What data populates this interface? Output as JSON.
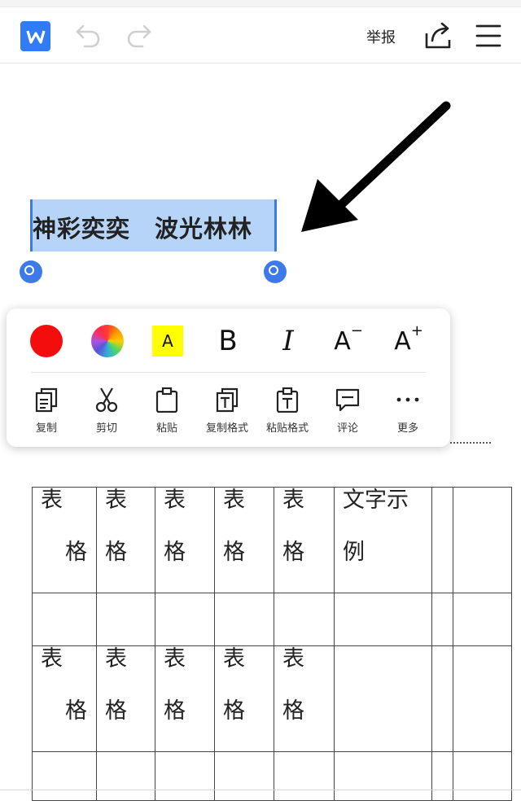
{
  "toolbar": {
    "logo_letter": "W",
    "report_label": "举报",
    "icons": [
      "wps-logo-icon",
      "undo-icon",
      "redo-icon",
      "share-icon",
      "menu-icon"
    ],
    "accent_color": "#2f7cf6"
  },
  "document": {
    "heading": "神彩奕奕　波光林林",
    "selection_color": "#b6d3f8"
  },
  "context_menu": {
    "format_buttons": {
      "font_color": "#f30d0d",
      "highlight_letter": "A",
      "highlight_color": "#ffff00",
      "bold": "B",
      "italic": "I",
      "decrease_font": "A",
      "decrease_sign": "−",
      "increase_font": "A",
      "increase_sign": "+"
    },
    "actions": [
      {
        "label": "复制",
        "icon": "copy-icon"
      },
      {
        "label": "剪切",
        "icon": "scissors-icon"
      },
      {
        "label": "粘贴",
        "icon": "clipboard-icon"
      },
      {
        "label": "复制格式",
        "icon": "copy-format-icon"
      },
      {
        "label": "粘贴格式",
        "icon": "paste-format-icon"
      },
      {
        "label": "评论",
        "icon": "comment-icon"
      },
      {
        "label": "更多",
        "icon": "more-icon"
      }
    ]
  },
  "table": {
    "rows": [
      [
        "表格",
        "表格",
        "表格",
        "表格",
        "表格",
        "文字示例",
        "",
        ""
      ],
      [
        "",
        "",
        "",
        "",
        "",
        "",
        "",
        ""
      ],
      [
        "表格",
        "表格",
        "表格",
        "表格",
        "表格",
        "",
        "",
        ""
      ],
      [
        "",
        "",
        "",
        "",
        "",
        "",
        "",
        ""
      ]
    ]
  }
}
